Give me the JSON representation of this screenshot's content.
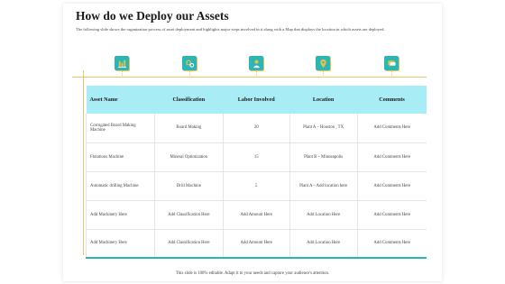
{
  "slide": {
    "title": "How do we Deploy our Assets",
    "subtitle": "The following slide shows the organization process of asset deployment and highlights major steps involved in it along with a Map that displays the location in which assets are deployed.",
    "footer": "This slide is 100% editable. Adapt it to your needs and capture your audience's attention."
  },
  "icons": [
    "factory-icon",
    "gears-icon",
    "worker-icon",
    "location-pin-icon",
    "chat-icon"
  ],
  "colors": {
    "accent": "#2bb5b5",
    "header_bg": "#a8ecf5",
    "line": "#f0c36a"
  },
  "table": {
    "headers": [
      "Asset Name",
      "Classification",
      "Labor Involved",
      "Location",
      "Comments"
    ],
    "rows": [
      [
        "Corrugated Board Making Machine",
        "Board Making",
        "20",
        "Plant A – Houston , TX",
        "Add Comments Here"
      ],
      [
        "Flotations Machine",
        "Mineral Optimization",
        "15",
        "Plant B – Minneapolis",
        "Add Comments Here"
      ],
      [
        "Automatic drilling Machine",
        "Drill Machine",
        "5",
        "Plant A – Add location here",
        "Add Comments Here"
      ],
      [
        "Add Machinery Here",
        "Add Classification Here",
        "Add Amount Here",
        "Add Location Here",
        "Add Comments Here"
      ],
      [
        "Add Machinery Here",
        "Add Classification Here",
        "Add Amount Here",
        "Add Location Here",
        "Add Comments Here"
      ]
    ]
  }
}
